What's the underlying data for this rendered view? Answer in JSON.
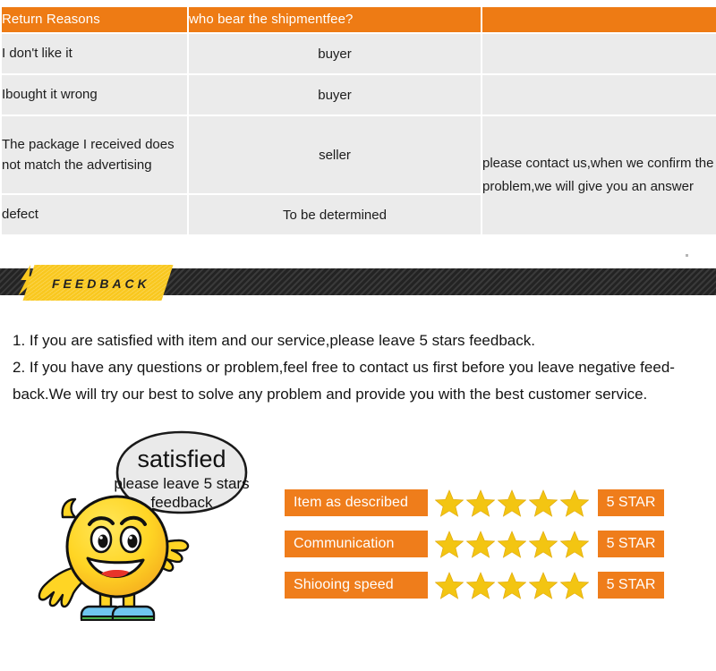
{
  "table": {
    "headers": [
      "Return Reasons",
      "who bear the shipmentfee?",
      ""
    ],
    "rows": [
      {
        "reason": "I don't like it",
        "payer": "buyer",
        "note": ""
      },
      {
        "reason": "Ibought it wrong",
        "payer": "buyer",
        "note": ""
      },
      {
        "reason": "The package I received does not match the advertising",
        "payer": "seller",
        "note": "please contact us,when we confirm the problem,we will give you an answer"
      },
      {
        "reason": "defect",
        "payer": "To be determined",
        "note": ""
      }
    ]
  },
  "banner": {
    "title": "FEEDBACK"
  },
  "notes": {
    "line1": "1. If you are satisfied with item and our service,please leave 5 stars feedback.",
    "line2": "2. If you have any questions or problem,feel free to contact us first before you leave negative feed-",
    "line3": "back.We will try our best to solve any problem and provide you with the best customer service."
  },
  "bubble": {
    "headline": "satisfied",
    "line2": "please leave 5 stars",
    "line3": "feedback"
  },
  "ratings": [
    {
      "label": "Item as described",
      "stars": 5,
      "badge": "5 STAR"
    },
    {
      "label": "Communication",
      "stars": 5,
      "badge": "5 STAR"
    },
    {
      "label": "Shiooing speed",
      "stars": 5,
      "badge": "5 STAR"
    }
  ],
  "colors": {
    "header_orange": "#ee7b14",
    "cell_grey": "#ebebeb",
    "banner_yellow": "#f9c81f",
    "banner_dark": "#2f2f2f",
    "rating_orange": "#ef7d1b",
    "star_gold": "#f5c518"
  }
}
